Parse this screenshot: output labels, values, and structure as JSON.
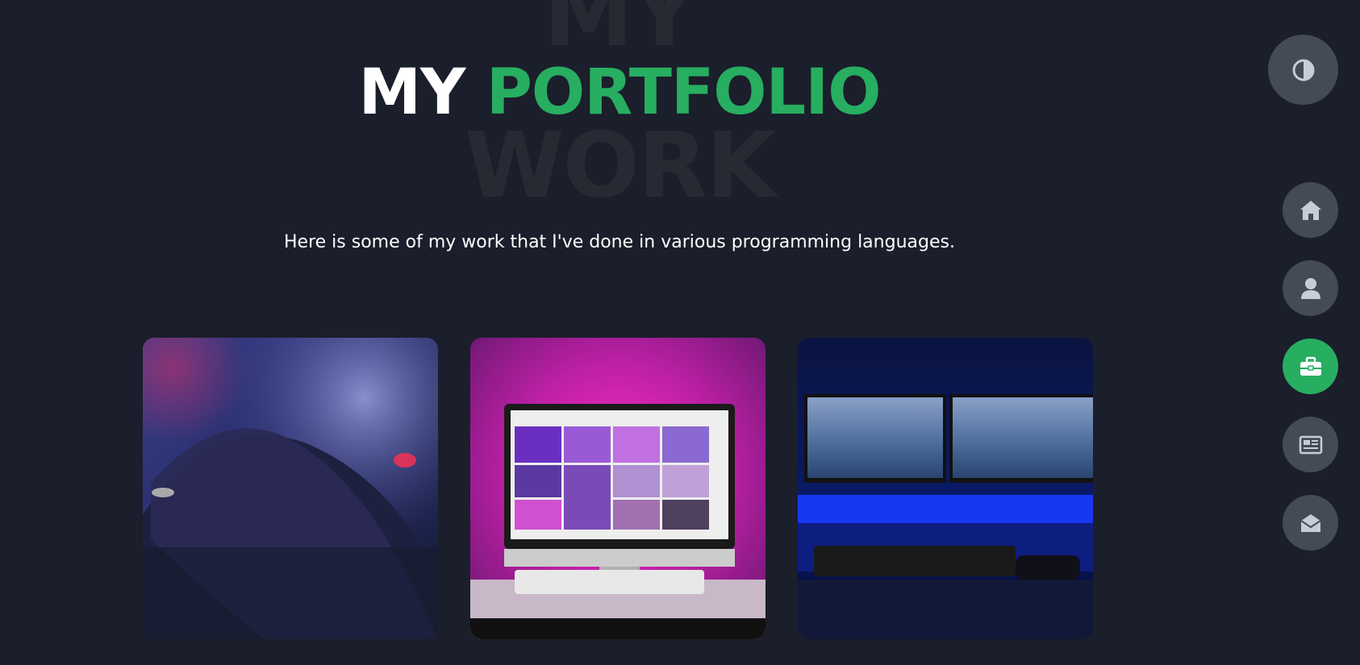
{
  "heading": {
    "bg_top": "MY",
    "bg_bottom": "WORK",
    "title_white": "MY",
    "title_green": "PORTFOLIO"
  },
  "subtitle": "Here is some of my work that I've done in various programming languages.",
  "colors": {
    "background": "#1b1e2b",
    "accent": "#27ae60",
    "nav_button": "#454b54",
    "icon": "#c8ccd4"
  },
  "theme_toggle": {
    "icon": "contrast-icon"
  },
  "nav": {
    "items": [
      {
        "id": "home",
        "icon": "home-icon",
        "active": false
      },
      {
        "id": "about",
        "icon": "user-icon",
        "active": false
      },
      {
        "id": "portfolio",
        "icon": "briefcase-icon",
        "active": true
      },
      {
        "id": "blogs",
        "icon": "newspaper-icon",
        "active": false
      },
      {
        "id": "contact",
        "icon": "envelope-open-icon",
        "active": false
      }
    ]
  },
  "portfolio": {
    "items": [
      {
        "image": "hand-on-keyboard-image"
      },
      {
        "image": "pink-desk-monitor-image"
      },
      {
        "image": "blue-dual-monitor-image"
      }
    ]
  }
}
